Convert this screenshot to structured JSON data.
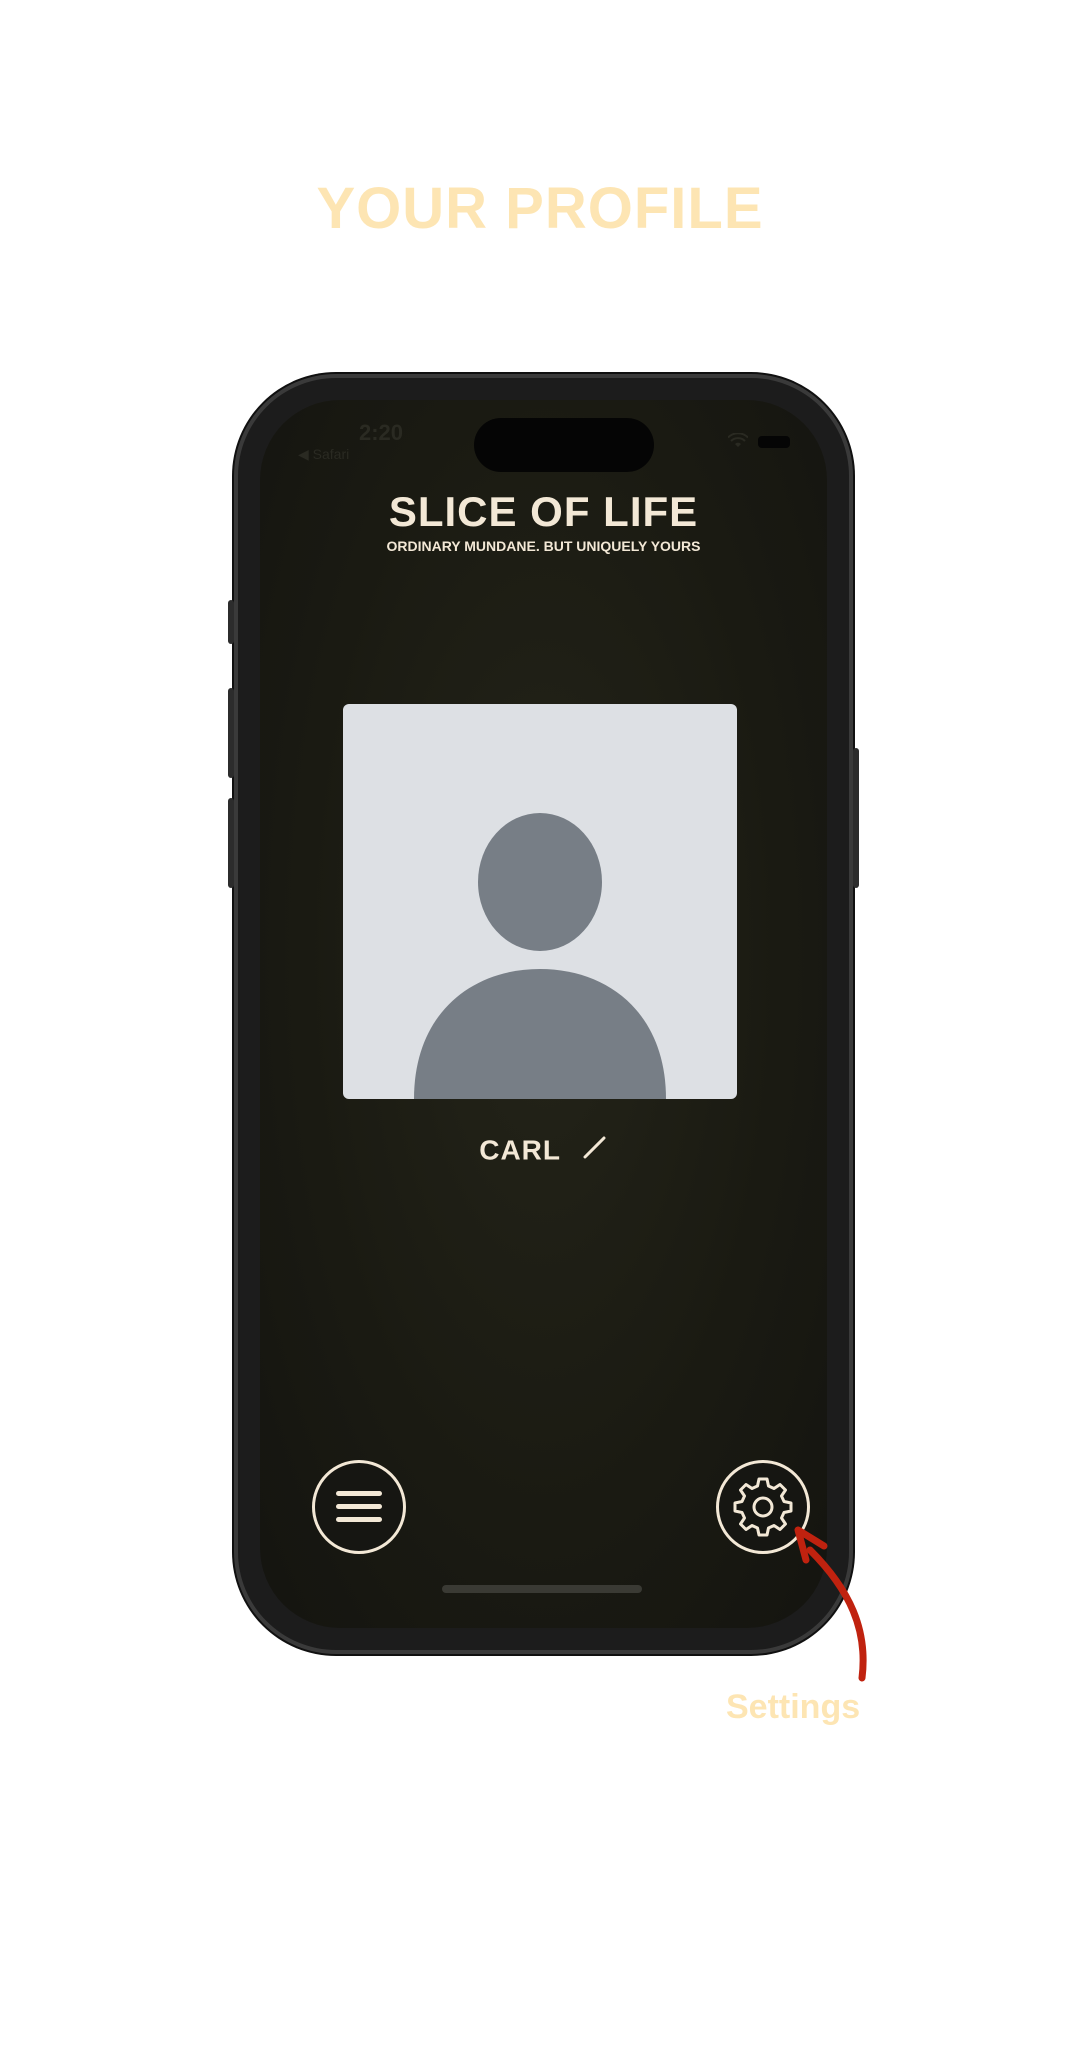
{
  "page": {
    "title": "YOUR PROFILE"
  },
  "status_bar": {
    "time": "2:20",
    "back_label": "◀ Safari"
  },
  "app": {
    "title": "SLICE OF LIFE",
    "subtitle": "ORDINARY MUNDANE. BUT UNIQUELY YOURS"
  },
  "profile": {
    "name": "CARL",
    "avatar_icon": "person-placeholder-icon",
    "edit_icon": "pencil-icon"
  },
  "controls": {
    "menu_icon": "hamburger-menu-icon",
    "settings_icon": "gear-icon"
  },
  "annotation": {
    "label": "Settings",
    "arrow_color": "#c0220f"
  },
  "colors": {
    "accent_cream": "#f3e8d6",
    "title_peach": "#fde5b3",
    "screen_bg": "#1a1a12",
    "avatar_bg": "#dde0e4",
    "avatar_figure": "#777e86"
  }
}
